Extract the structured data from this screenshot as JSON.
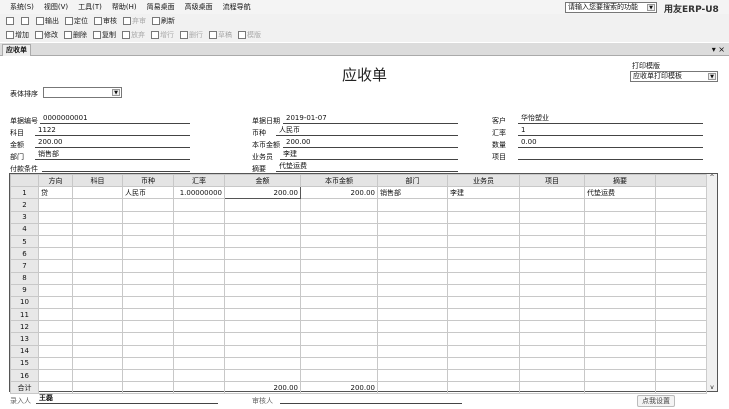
{
  "menu": [
    "系统(S)",
    "视图(V)",
    "工具(T)",
    "帮助(H)",
    "简易桌面",
    "高级桌面",
    "流程导航"
  ],
  "toolbar1": [
    {
      "l": "输出",
      "d": false
    },
    {
      "l": "定位",
      "d": false
    },
    {
      "l": "审核",
      "d": false
    },
    {
      "l": "弃审",
      "d": true
    },
    {
      "l": "刷新",
      "d": false
    }
  ],
  "toolbar2": [
    {
      "l": "增加",
      "d": false
    },
    {
      "l": "修改",
      "d": false
    },
    {
      "l": "删除",
      "d": false
    },
    {
      "l": "复制",
      "d": false
    },
    {
      "l": "放弃",
      "d": true
    },
    {
      "l": "增行",
      "d": true
    },
    {
      "l": "删行",
      "d": true
    },
    {
      "l": "草稿",
      "d": true
    },
    {
      "l": "模版",
      "d": true
    }
  ],
  "search": {
    "placeholder": "请输入您要搜索的功能"
  },
  "brand": "用友ERP-U8",
  "tab": "应收单",
  "window_controls": "▾ ×",
  "form": {
    "title": "应收单",
    "print_template_label": "打印模版",
    "print_template": "应收单打印模板",
    "sort_label": "表体排序",
    "doc_no_label": "单据编号",
    "doc_no": "0000000001",
    "date_label": "单据日期",
    "date": "2019-01-07",
    "customer_label": "客户",
    "customer": "华怡塑业",
    "account_label": "科目",
    "account": "1122",
    "currency_label": "币种",
    "currency": "人民币",
    "rate_label": "汇率",
    "rate": "1",
    "amount_label": "金额",
    "amount": "200.00",
    "local_amount_label": "本币金额",
    "local_amount": "200.00",
    "qty_label": "数量",
    "qty": "0.00",
    "dept_label": "部门",
    "dept": "销售部",
    "salesman_label": "业务员",
    "salesman": "李建",
    "project_label": "项目",
    "project": "",
    "terms_label": "付款条件",
    "terms": "",
    "memo_label": "摘要",
    "memo": "代垫运费"
  },
  "grid": {
    "headers": [
      "",
      "方向",
      "科目",
      "币种",
      "汇率",
      "金额",
      "本币金额",
      "部门",
      "业务员",
      "项目",
      "摘要",
      ""
    ],
    "rows": [
      [
        "1",
        "贷",
        "",
        "人民币",
        "1.00000000",
        "200.00",
        "200.00",
        "销售部",
        "李建",
        "",
        "代垫运费",
        ""
      ]
    ],
    "row_count": 16,
    "total": [
      "合计",
      "",
      "",
      "",
      "",
      "200.00",
      "200.00",
      "",
      "",
      "",
      "",
      ""
    ]
  },
  "footer": {
    "entry_label": "录入人",
    "entry": "王磊",
    "audit_label": "审核人",
    "audit": "",
    "settings": "点我设置"
  }
}
